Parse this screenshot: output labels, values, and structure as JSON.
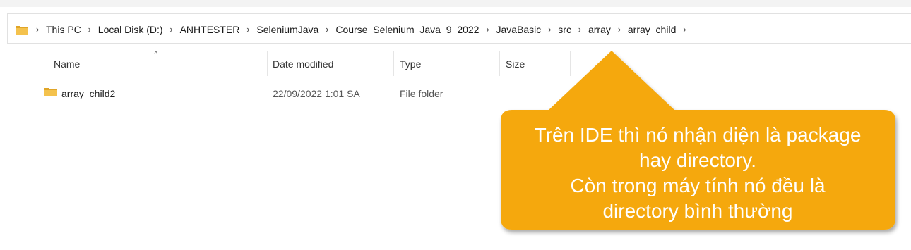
{
  "breadcrumb": {
    "items": [
      "This PC",
      "Local Disk (D:)",
      "ANHTESTER",
      "SeleniumJava",
      "Course_Selenium_Java_9_2022",
      "JavaBasic",
      "src",
      "array",
      "array_child"
    ],
    "separator": "›"
  },
  "columns": {
    "name": "Name",
    "date_modified": "Date modified",
    "type": "Type",
    "size": "Size"
  },
  "sort_indicator": "^",
  "rows": [
    {
      "name": "array_child2",
      "date_modified": "22/09/2022 1:01 SA",
      "type": "File folder",
      "size": ""
    }
  ],
  "callout": {
    "lines": [
      "Trên IDE thì nó nhận diện là package",
      "hay directory.",
      "Còn trong máy tính nó đều là",
      "directory bình thường"
    ],
    "color": "#F5A80E"
  },
  "colors": {
    "folder": "#F4C24D",
    "folder_dark": "#E0A528"
  }
}
